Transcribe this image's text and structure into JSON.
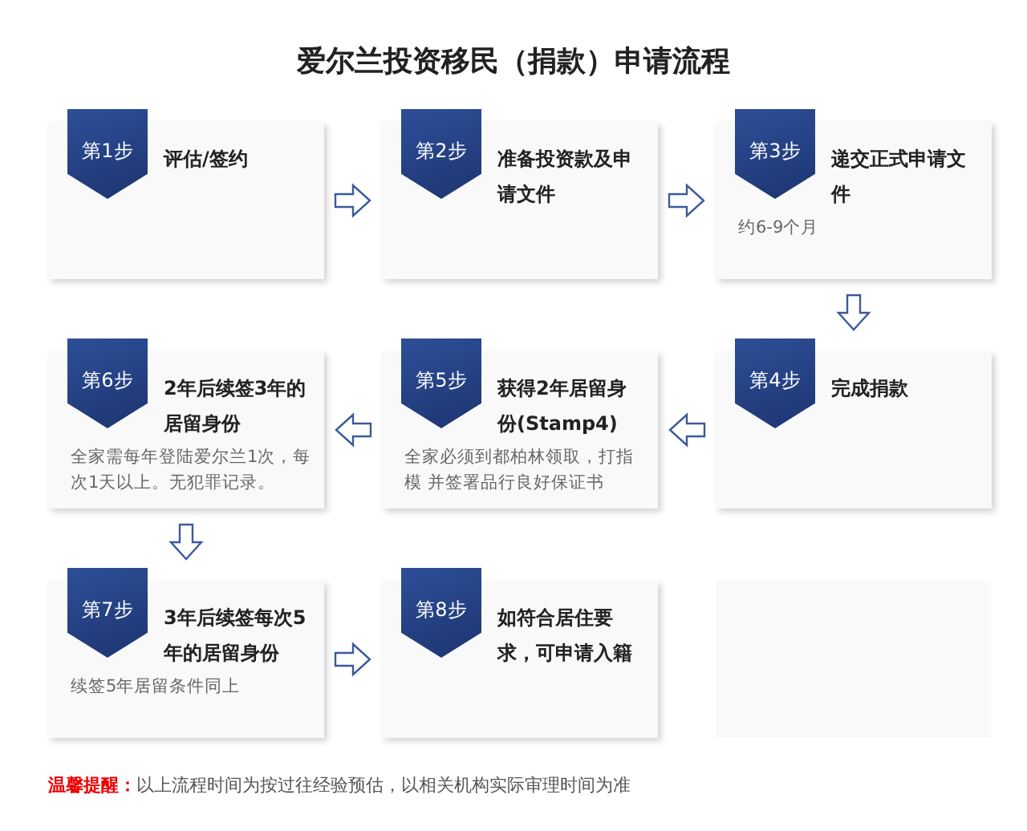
{
  "title": "爱尔兰投资移民（捐款）申请流程",
  "rows": [
    {
      "reversed": false,
      "cells": [
        {
          "kind": "step",
          "badge": "第1步",
          "title": "评估/签约"
        },
        {
          "kind": "step",
          "badge": "第2步",
          "title": "准备投资款及申请文件"
        },
        {
          "kind": "step",
          "badge": "第3步",
          "title": "递交正式申请文件",
          "note": "约6-9个月"
        }
      ]
    },
    {
      "reversed": true,
      "cells": [
        {
          "kind": "step",
          "badge": "第6步",
          "title": "2年后续签3年的居留身份",
          "note": "全家需每年登陆爱尔兰1次，每次1天以上。无犯罪记录。"
        },
        {
          "kind": "step",
          "badge": "第5步",
          "title": "获得2年居留身份(Stamp4)",
          "note": "全家必须到都柏林领取，打指模 并签署品行良好保证书"
        },
        {
          "kind": "step",
          "badge": "第4步",
          "title": "完成捐款"
        }
      ]
    },
    {
      "reversed": false,
      "cells": [
        {
          "kind": "step",
          "badge": "第7步",
          "title": "3年后续签每次5年的居留身份",
          "note": "续签5年居留条件同上"
        },
        {
          "kind": "step",
          "badge": "第8步",
          "title": "如符合居住要求，可申请入籍"
        },
        {
          "kind": "blank"
        }
      ]
    }
  ],
  "reminder": {
    "label": "温馨提醒：",
    "text": "以上流程时间为按过往经验预估，以相关机构实际审理时间为准"
  }
}
